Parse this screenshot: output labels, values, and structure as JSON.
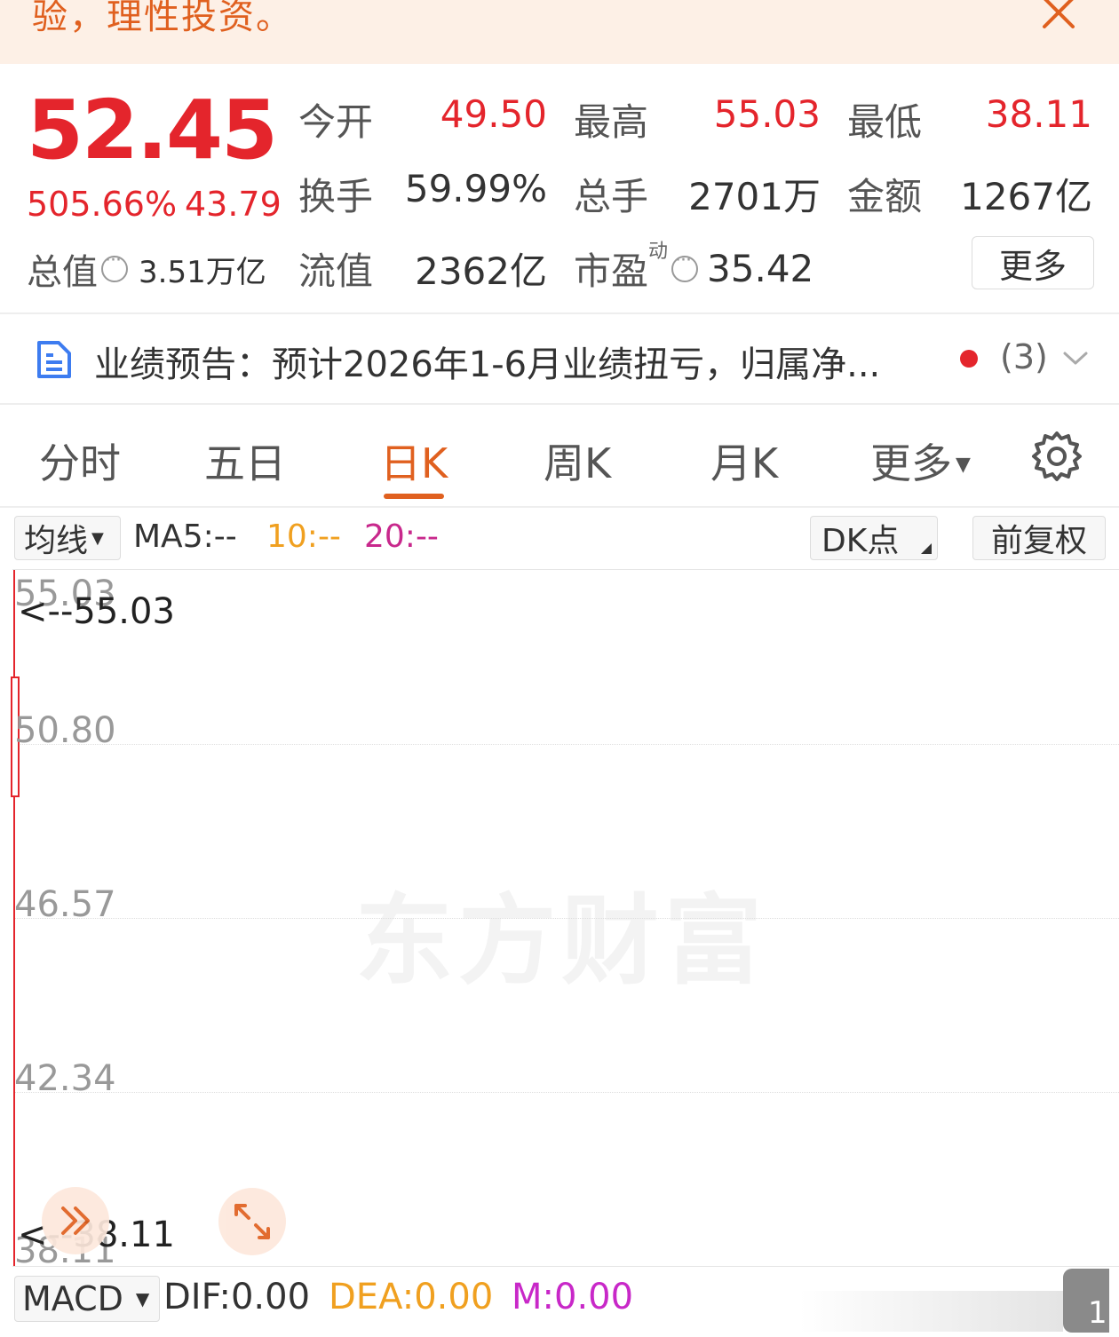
{
  "banner": {
    "text": "验，理性投资。",
    "close_icon": "close-icon"
  },
  "quote": {
    "price": "52.45",
    "change_pct": "505.66%",
    "change": "43.79",
    "total_value_label": "总值",
    "total_value": "3.51万亿",
    "open_label": "今开",
    "open": "49.50",
    "high_label": "最高",
    "high": "55.03",
    "low_label": "最低",
    "low": "38.11",
    "turnover_label": "换手",
    "turnover": "59.99%",
    "volume_label": "总手",
    "volume": "2701万",
    "amount_label": "金额",
    "amount": "1267亿",
    "float_value_label": "流值",
    "float_value": "2362亿",
    "pe_label": "市盈",
    "pe_sup": "动",
    "pe": "35.42",
    "more_label": "更多",
    "price_color": "#e4252c"
  },
  "notice": {
    "text": "业绩预告：预计2026年1-6月业绩扭亏，归属净...",
    "count": "(3)",
    "icon": "document-icon"
  },
  "tabs": [
    {
      "label": "分时"
    },
    {
      "label": "五日"
    },
    {
      "label": "日K",
      "active": true
    },
    {
      "label": "周K"
    },
    {
      "label": "月K"
    },
    {
      "label": "更多"
    }
  ],
  "accent_color": "#e0601f",
  "toolbar": {
    "ma_label": "均线",
    "ma5": "MA5:--",
    "ma10": "10:--",
    "ma20": "20:--",
    "ma10_color": "#f0a020",
    "ma20_color": "#c8288c",
    "dk_label": "DK点",
    "fq_label": "前复权"
  },
  "chart": {
    "y_labels": [
      "55.03",
      "50.80",
      "46.57",
      "42.34",
      "38.11"
    ],
    "high_marker": "<--55.03",
    "low_marker": "<--38.11",
    "watermark": "东方财富"
  },
  "macd": {
    "label": "MACD",
    "dif": "DIF:0.00",
    "dea": "DEA:0.00",
    "m": "M:0.00",
    "dea_color": "#f0a020",
    "m_color": "#c828c8",
    "scroll_badge": "1"
  }
}
